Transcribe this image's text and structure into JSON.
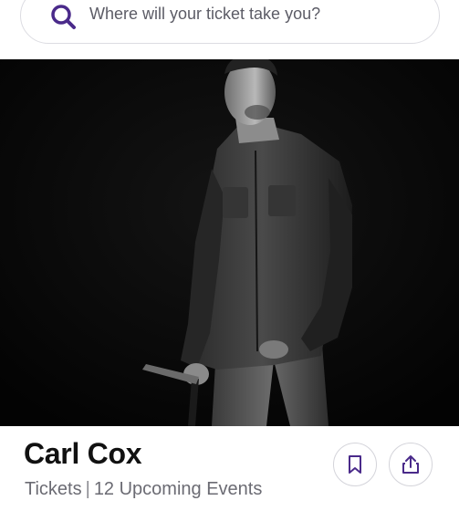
{
  "search": {
    "placeholder": "Where will your ticket take you?",
    "icon": "search-icon",
    "accent_color": "#4a2a8a"
  },
  "hero": {
    "image_alt": "Carl Cox"
  },
  "artist": {
    "name": "Carl Cox",
    "tickets_label": "Tickets",
    "separator": "|",
    "events_label": "12 Upcoming Events"
  },
  "actions": {
    "bookmark_icon": "bookmark-icon",
    "share_icon": "share-icon"
  }
}
